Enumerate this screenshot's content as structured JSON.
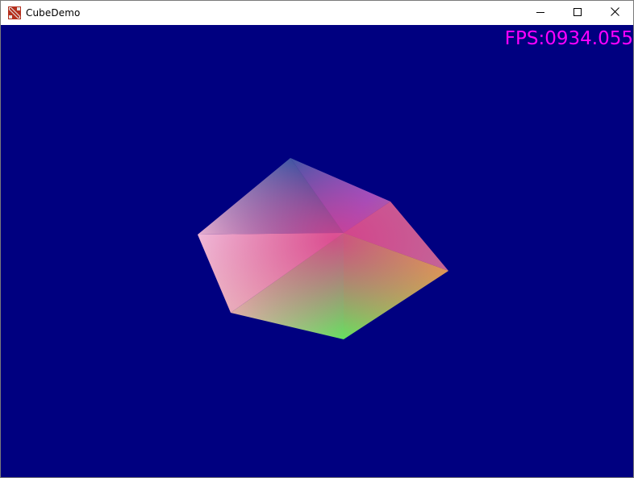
{
  "window": {
    "title": "CubeDemo",
    "app_icon": "dota-logo-icon",
    "controls": {
      "minimize_icon": "minimize-icon",
      "maximize_icon": "maximize-icon",
      "close_icon": "close-icon"
    }
  },
  "viewport": {
    "background_color": "#000080",
    "fps_text": "FPS:0934.055",
    "fps_color": "#ff00ff"
  },
  "scene": {
    "object": "rotating-color-cube",
    "vertex_colors": [
      "#e8b4c8",
      "#2f5aa8",
      "#7f5ae0",
      "#e0a050",
      "#66e060",
      "#e0a0a8",
      "#d83c88"
    ]
  }
}
